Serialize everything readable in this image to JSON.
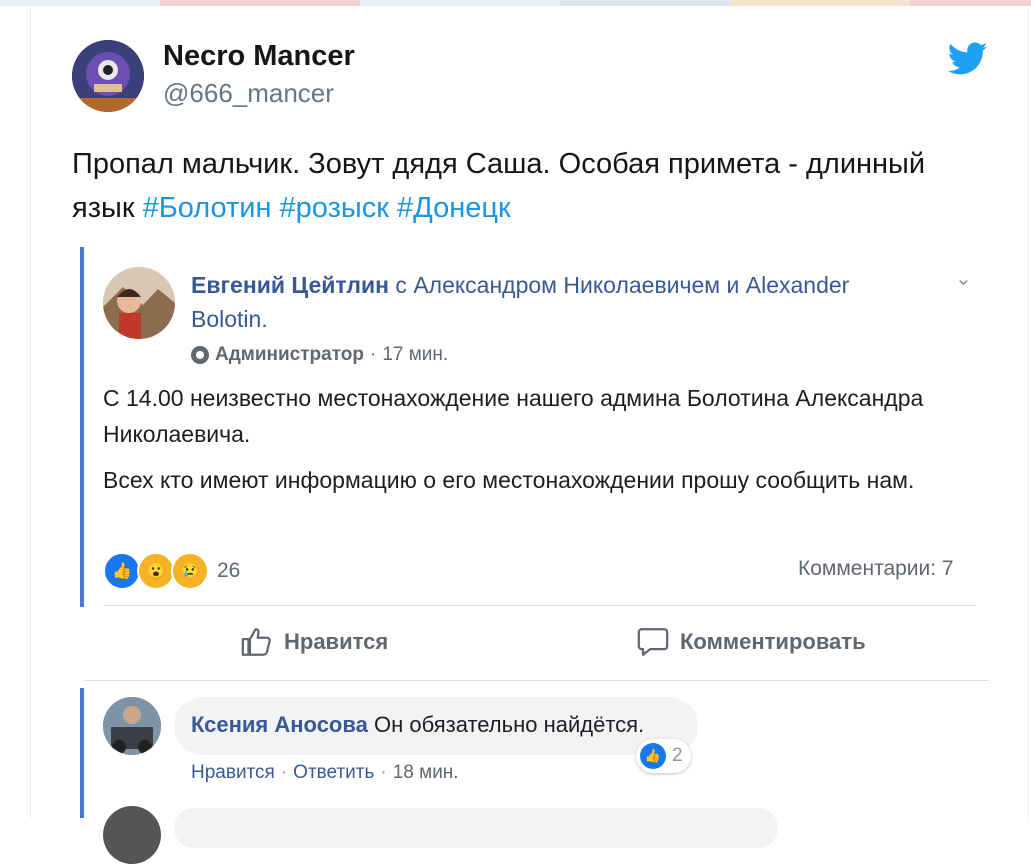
{
  "tweet": {
    "author_name": "Necro Mancer",
    "author_handle": "@666_mancer",
    "text_plain": "Пропал мальчик. Зовут дядя Саша. Особая примета - длинный язык ",
    "hashtags": [
      "#Болотин",
      "#розыск",
      "#Донецк"
    ],
    "brand_icon": "twitter-bird-icon",
    "brand_color": "#1da1f2",
    "hashtag_color": "#1b95e0"
  },
  "facebook_post": {
    "author": "Евгений Цейтлин",
    "with_word": "с",
    "tagged_1": "Александром Николаевичем",
    "and_word": "и",
    "tagged_2": "Alexander Bolotin.",
    "role": "Администратор",
    "time": "17 мин.",
    "paragraphs": [
      "С 14.00 неизвестно местонахождение нашего админа Болотина Александра Николаевича.",
      "Всех кто имеют информацию о его местонахождении прошу сообщить нам."
    ],
    "reaction_count": "26",
    "comments_label": "Комментарии: 7",
    "like_action": "Нравится",
    "comment_action": "Комментировать",
    "accent_color": "#4a76d8"
  },
  "comment": {
    "author": "Ксения Аносова",
    "text": "Он обязательно найдётся.",
    "reaction_count": "2",
    "like_link": "Нравится",
    "reply_link": "Ответить",
    "time": "18 мин."
  }
}
